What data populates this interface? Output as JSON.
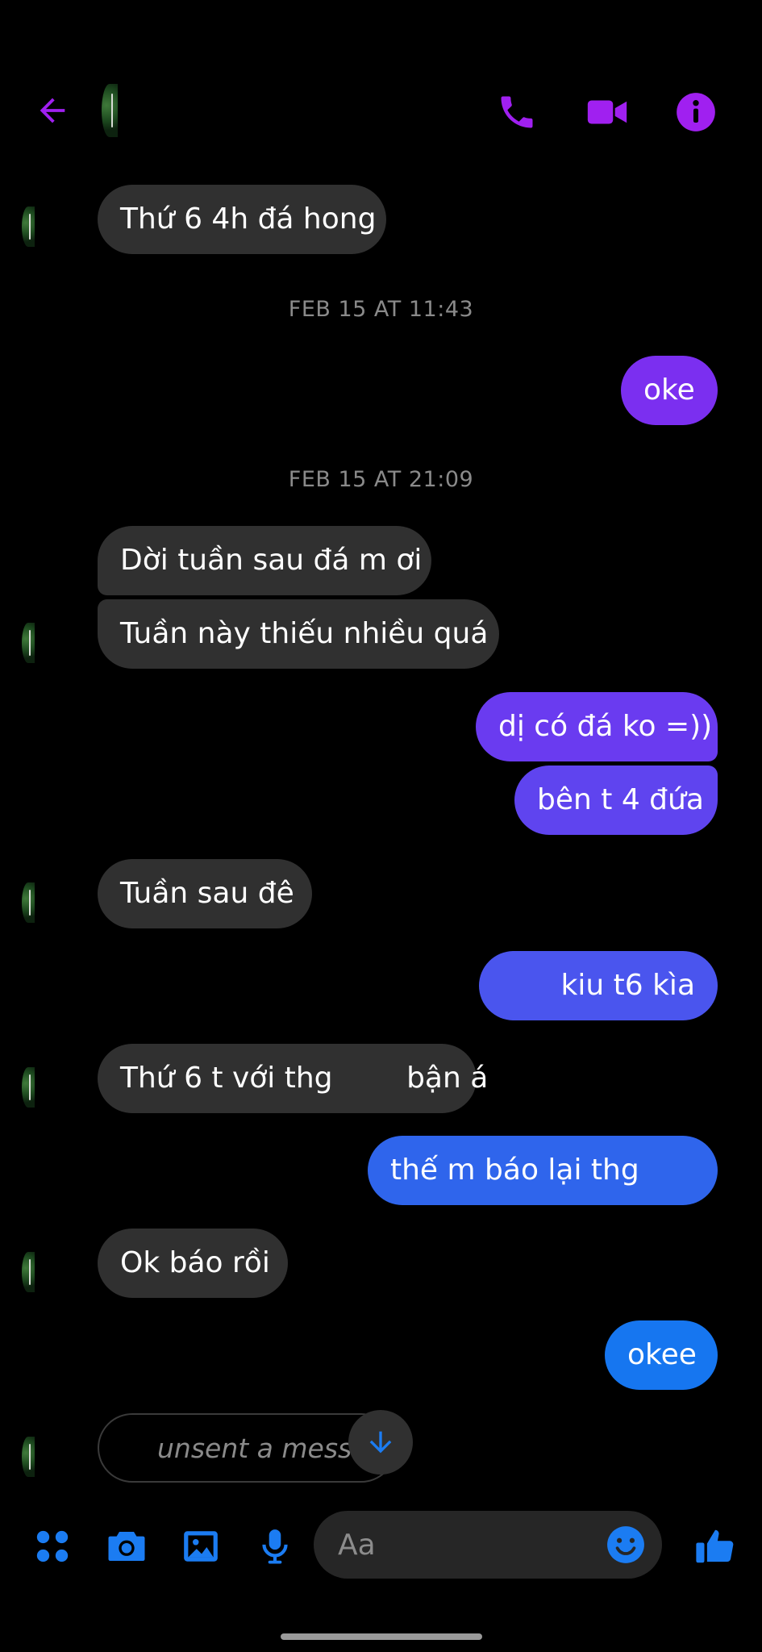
{
  "header": {
    "back_icon": "arrow-left-icon",
    "call_icon": "phone-icon",
    "video_icon": "video-camera-icon",
    "info_icon": "info-icon",
    "accent_color": "#a020f0"
  },
  "messages": [
    {
      "type": "received",
      "text": "Thứ 6 4h đá hong"
    },
    {
      "type": "timestamp",
      "text": "FEB 15 AT 11:43"
    },
    {
      "type": "sent",
      "text": "oke",
      "color": "#7b2ff0"
    },
    {
      "type": "timestamp",
      "text": "FEB 15 AT 21:09"
    },
    {
      "type": "received",
      "text": "Dời tuần sau đá m ơi"
    },
    {
      "type": "received",
      "text": "Tuần này thiếu nhiều quá"
    },
    {
      "type": "sent",
      "text": "dị có đá ko =))",
      "color": "#6a3bf0"
    },
    {
      "type": "sent",
      "text": "bên t 4 đứa",
      "color": "#5f44ef"
    },
    {
      "type": "received",
      "text": "Tuần sau đê"
    },
    {
      "type": "sent",
      "text": "kiu t6 kìa",
      "color": "#4a55ee"
    },
    {
      "type": "received",
      "text": "Thứ 6 t với thg        bận á"
    },
    {
      "type": "sent",
      "text": "thế m báo lại thg",
      "color": "#2f65ec"
    },
    {
      "type": "received",
      "text": "Ok báo rồi"
    },
    {
      "type": "sent",
      "text": "okee",
      "color": "#1676f0"
    },
    {
      "type": "unsent",
      "text": "unsent a message"
    }
  ],
  "scroll_down_icon": "arrow-down-icon",
  "composer": {
    "menu_icon": "four-dots-icon",
    "camera_icon": "camera-icon",
    "gallery_icon": "image-icon",
    "mic_icon": "microphone-icon",
    "placeholder": "Aa",
    "emoji_icon": "smiley-icon",
    "like_icon": "thumbs-up-icon",
    "accent_color": "#1b7cf2"
  }
}
